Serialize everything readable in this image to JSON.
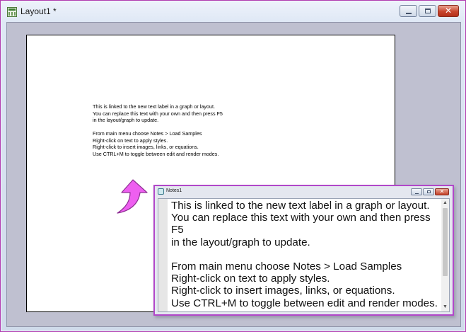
{
  "window": {
    "title": "Layout1 *",
    "icon": "layout-icon",
    "close_glyph": "✕"
  },
  "page_text": {
    "lines": [
      "This is linked to the new text label in a graph or layout.",
      "You can replace this text with your own and then press  F5",
      "in the layout/graph to update.",
      "",
      "From main menu choose Notes > Load Samples",
      "Right-click on text to apply styles.",
      "Right-click to insert images, links, or equations.",
      "Use CTRL+M to toggle between edit and render modes."
    ]
  },
  "notes_window": {
    "title": "Notes1",
    "icon": "notes-icon",
    "close_glyph": "✕",
    "lines": [
      "This is linked to the new text label in a graph or layout.",
      "You can replace this text with your own and then press",
      "F5",
      "in the layout/graph to update.",
      "",
      "From main menu choose Notes > Load Samples",
      "Right-click on text to apply styles.",
      "Right-click to insert images, links, or equations.",
      "Use CTRL+M to toggle between edit and render modes."
    ],
    "scroll_up_glyph": "▲",
    "scroll_down_glyph": "▼"
  },
  "colors": {
    "accent_border": "#b147c9",
    "arrow_fill": "#ee5ff0",
    "client_background": "#bfc0d0"
  }
}
